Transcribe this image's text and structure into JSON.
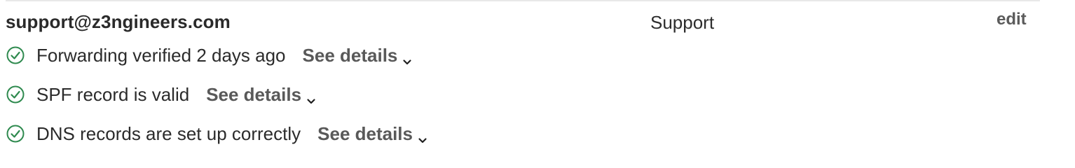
{
  "row": {
    "email": "support@z3ngineers.com",
    "mailbox_name": "Support",
    "edit_label": "edit"
  },
  "checks": [
    {
      "text": "Forwarding verified 2 days ago",
      "details_label": "See details",
      "status": "valid",
      "icon": "check-circle-icon",
      "color": "#2f8a4f"
    },
    {
      "text": "SPF record is valid",
      "details_label": "See details",
      "status": "valid",
      "icon": "check-circle-icon",
      "color": "#2f8a4f"
    },
    {
      "text": "DNS records are set up correctly",
      "details_label": "See details",
      "status": "valid",
      "icon": "check-circle-icon",
      "color": "#2f8a4f"
    }
  ],
  "colors": {
    "success": "#2f8a4f",
    "divider": "#e8e8e8",
    "muted_link": "#595959"
  }
}
